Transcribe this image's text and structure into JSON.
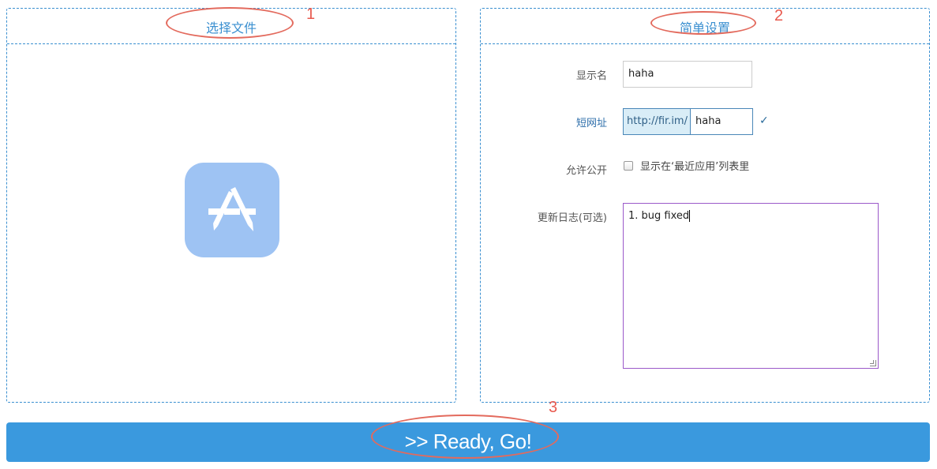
{
  "left_panel": {
    "title": "选择文件",
    "marker": "1",
    "upload_icon": "app-store-icon"
  },
  "right_panel": {
    "title": "简单设置",
    "marker": "2",
    "fields": {
      "display_name": {
        "label": "显示名",
        "value": "haha"
      },
      "short_url": {
        "label": "短网址",
        "prefix": "http://fir.im/",
        "value": "haha",
        "check": "✓"
      },
      "public": {
        "label": "允许公开",
        "option_text": "显示在‘最近应用’列表里",
        "checked": false
      },
      "changelog": {
        "label": "更新日志(可选)",
        "value": "1. bug fixed"
      }
    }
  },
  "submit": {
    "label": ">> Ready, Go!",
    "marker": "3"
  },
  "colors": {
    "accent": "#3a99de",
    "dashed_border": "#3a8fd0",
    "annotation": "#e36a5d",
    "icon_bg": "#9ec3f3"
  }
}
